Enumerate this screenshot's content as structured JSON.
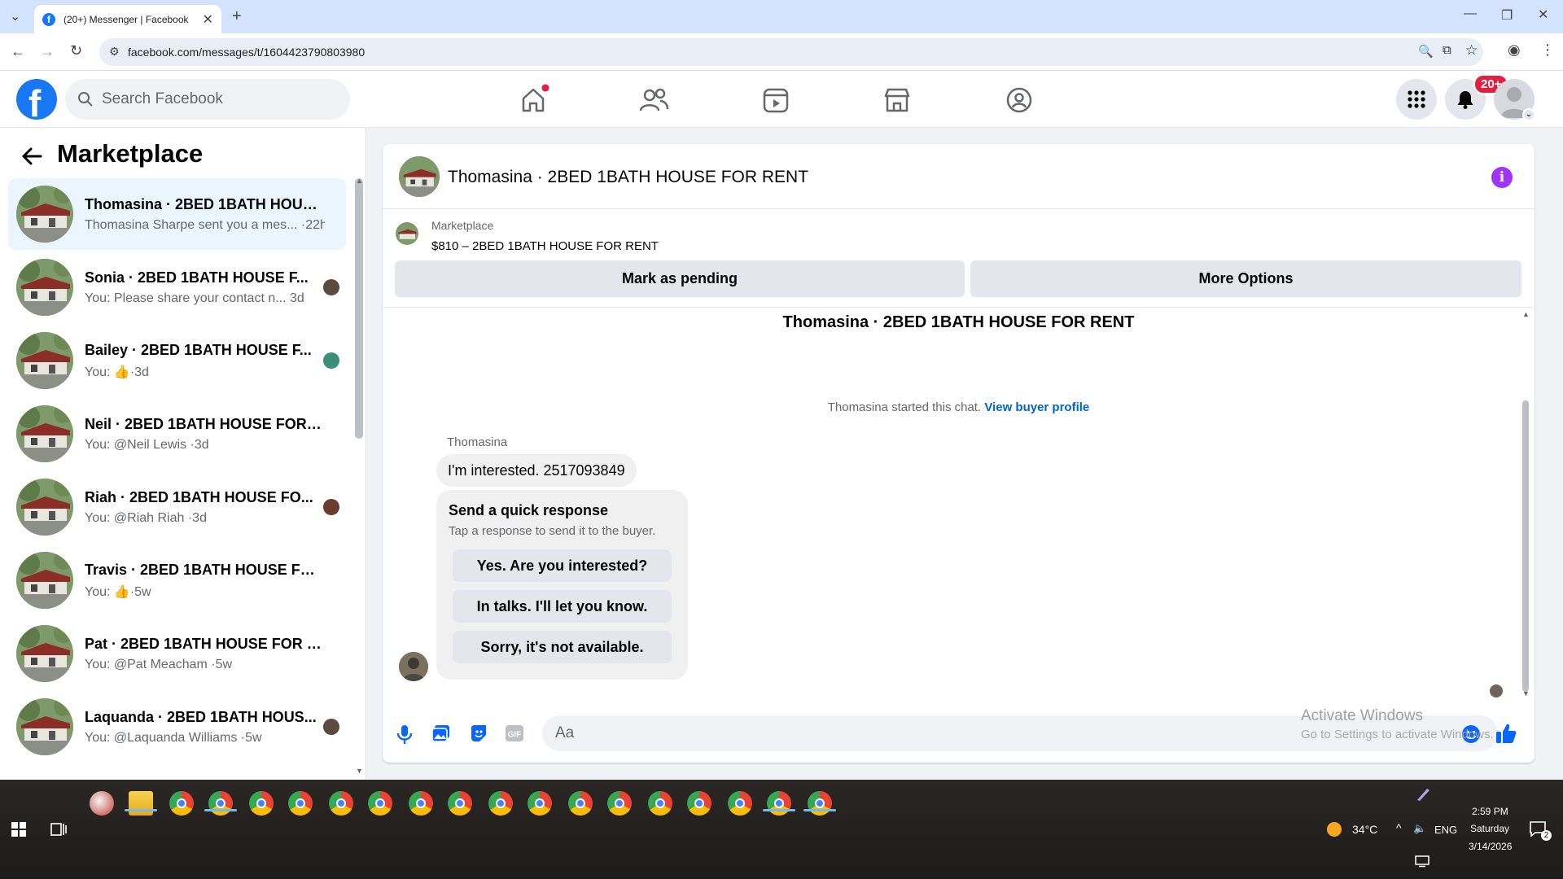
{
  "browser": {
    "tab_title": "(20+) Messenger | Facebook",
    "url": "facebook.com/messages/t/1604423790803980"
  },
  "header": {
    "search_placeholder": "Search Facebook",
    "notification_badge": "20+"
  },
  "sidebar": {
    "title": "Marketplace",
    "conversations": [
      {
        "name": "Thomasina · 2BED 1BATH HOUSE...",
        "preview": "Thomasina Sharpe sent you a mes...",
        "time": "·22h",
        "active": true
      },
      {
        "name": "Sonia · 2BED 1BATH HOUSE F...",
        "preview": "You: Please share your contact n...",
        "time": "3d"
      },
      {
        "name": "Bailey · 2BED 1BATH HOUSE F...",
        "preview": "You:",
        "time": "·3d",
        "thumb": true
      },
      {
        "name": "Neil · 2BED 1BATH HOUSE FOR R...",
        "preview": "You: @Neil Lewis",
        "time": "·3d"
      },
      {
        "name": "Riah · 2BED 1BATH HOUSE FO...",
        "preview": "You: @Riah Riah",
        "time": "·3d"
      },
      {
        "name": "Travis · 2BED 1BATH HOUSE FOR ...",
        "preview": "You:",
        "time": "·5w",
        "thumb": true
      },
      {
        "name": "Pat · 2BED 1BATH HOUSE FOR RE...",
        "preview": "You: @Pat Meacham",
        "time": "·5w"
      },
      {
        "name": "Laquanda · 2BED 1BATH HOUS...",
        "preview": "You: @Laquanda Williams",
        "time": "·5w"
      }
    ]
  },
  "chat": {
    "title": "Thomasina · 2BED 1BATH HOUSE FOR RENT",
    "listing_source": "Marketplace",
    "listing_price_title": "$810 – 2BED 1BATH HOUSE FOR RENT",
    "mark_pending": "Mark as pending",
    "more_options": "More Options",
    "center_title": "Thomasina · 2BED 1BATH HOUSE FOR RENT",
    "system_note": "Thomasina started this chat.",
    "view_profile": "View buyer profile",
    "sender_name": "Thomasina",
    "message": "I'm interested. 2517093849",
    "quick_title": "Send a quick response",
    "quick_sub": "Tap a response to send it to the buyer.",
    "quick_options": [
      "Yes. Are you interested?",
      "In talks. I'll let you know.",
      "Sorry, it's not available."
    ],
    "composer_placeholder": "Aa"
  },
  "watermark": {
    "line1": "Activate Windows",
    "line2": "Go to Settings to activate Windows."
  },
  "taskbar": {
    "temperature": "34°C",
    "language": "ENG",
    "time": "2:59 PM",
    "day": "Saturday",
    "date": "3/14/2026",
    "notif_count": "2"
  },
  "colors": {
    "fb_blue": "#1877f2",
    "messenger_purple": "#a033ff",
    "link_blue": "#0064d1",
    "notif_red": "#e41e3f"
  }
}
